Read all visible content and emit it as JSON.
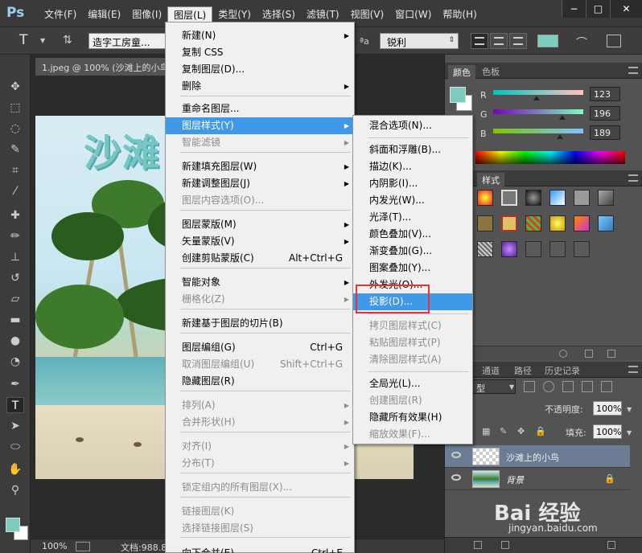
{
  "menubar": {
    "logo": "Ps",
    "items": [
      "文件(F)",
      "编辑(E)",
      "图像(I)",
      "图层(L)",
      "类型(Y)",
      "选择(S)",
      "滤镜(T)",
      "视图(V)",
      "窗口(W)",
      "帮助(H)"
    ],
    "active_index": 3,
    "win_minimize": "−",
    "win_restore": "□",
    "win_close": "✕"
  },
  "options": {
    "tool_glyph": "T",
    "font_family": "造字工房童...",
    "aa_glyph": "ªa",
    "antialias": "锐利",
    "accent_color": "#7ccdbf"
  },
  "document": {
    "tab_title": "1.jpeg @ 100% (沙滩上的小鸟...",
    "canvas_text": "沙滩",
    "zoom": "100%",
    "doc_size": "文档:988.8"
  },
  "color_panel": {
    "tabs": [
      "颜色",
      "色板"
    ],
    "channels": [
      {
        "label": "R",
        "value": "123",
        "fraction": 0.48
      },
      {
        "label": "G",
        "value": "196",
        "fraction": 0.77
      },
      {
        "label": "B",
        "value": "189",
        "fraction": 0.74
      }
    ],
    "foreground": "#7ccdbf"
  },
  "styles_panel": {
    "tab": "样式"
  },
  "layers_panel": {
    "tabs": [
      "通道",
      "路径",
      "历史记录"
    ],
    "kind": "型",
    "opacity_label": "不透明度:",
    "opacity": "100%",
    "fill_label": "填充:",
    "fill": "100%",
    "layers": [
      {
        "name": "沙滩上的小鸟",
        "selected": true
      },
      {
        "name": "背景",
        "selected": false
      }
    ]
  },
  "layer_menu": {
    "items": [
      {
        "label": "新建(N)",
        "arrow": true
      },
      {
        "label": "复制 CSS"
      },
      {
        "label": "复制图层(D)..."
      },
      {
        "label": "删除",
        "arrow": true
      },
      {
        "label": "重命名图层..."
      },
      {
        "label": "图层样式(Y)",
        "arrow": true,
        "highlighted": true
      },
      {
        "label": "智能滤镜",
        "arrow": true,
        "disabled": true
      },
      {
        "label": "新建填充图层(W)",
        "arrow": true
      },
      {
        "label": "新建调整图层(J)",
        "arrow": true
      },
      {
        "label": "图层内容选项(O)...",
        "disabled": true
      },
      {
        "label": "图层蒙版(M)",
        "arrow": true
      },
      {
        "label": "矢量蒙版(V)",
        "arrow": true
      },
      {
        "label": "创建剪贴蒙版(C)",
        "shortcut": "Alt+Ctrl+G"
      },
      {
        "label": "智能对象",
        "arrow": true
      },
      {
        "label": "栅格化(Z)",
        "arrow": true,
        "disabled": true
      },
      {
        "label": "新建基于图层的切片(B)"
      },
      {
        "label": "图层编组(G)",
        "shortcut": "Ctrl+G"
      },
      {
        "label": "取消图层编组(U)",
        "shortcut": "Shift+Ctrl+G",
        "disabled": true
      },
      {
        "label": "隐藏图层(R)"
      },
      {
        "label": "排列(A)",
        "arrow": true,
        "disabled": true
      },
      {
        "label": "合并形状(H)",
        "arrow": true,
        "disabled": true
      },
      {
        "label": "对齐(I)",
        "arrow": true,
        "disabled": true
      },
      {
        "label": "分布(T)",
        "arrow": true,
        "disabled": true
      },
      {
        "label": "锁定组内的所有图层(X)...",
        "disabled": true
      },
      {
        "label": "链接图层(K)",
        "disabled": true
      },
      {
        "label": "选择链接图层(S)",
        "disabled": true
      },
      {
        "label": "向下合并(E)",
        "shortcut": "Ctrl+E"
      }
    ]
  },
  "style_submenu": {
    "items": [
      {
        "label": "混合选项(N)..."
      },
      {
        "label": "斜面和浮雕(B)..."
      },
      {
        "label": "描边(K)..."
      },
      {
        "label": "内阴影(I)..."
      },
      {
        "label": "内发光(W)..."
      },
      {
        "label": "光泽(T)..."
      },
      {
        "label": "颜色叠加(V)..."
      },
      {
        "label": "渐变叠加(G)..."
      },
      {
        "label": "图案叠加(Y)..."
      },
      {
        "label": "外发光(O)..."
      },
      {
        "label": "投影(D)...",
        "highlighted": true
      },
      {
        "label": "拷贝图层样式(C)",
        "disabled": true
      },
      {
        "label": "粘贴图层样式(P)",
        "disabled": true
      },
      {
        "label": "清除图层样式(A)",
        "disabled": true
      },
      {
        "label": "全局光(L)..."
      },
      {
        "label": "创建图层(R)",
        "disabled": true
      },
      {
        "label": "隐藏所有效果(H)"
      },
      {
        "label": "缩放效果(F)...",
        "disabled": true
      }
    ]
  },
  "watermark": {
    "brand": "Bai 经验",
    "url": "jingyan.baidu.com"
  }
}
